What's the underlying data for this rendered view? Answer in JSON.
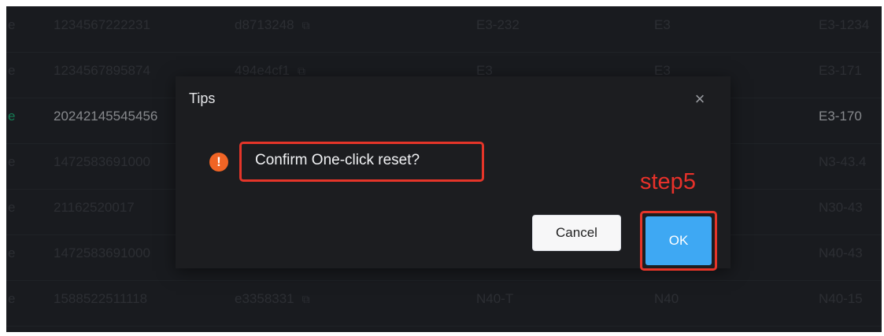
{
  "table": {
    "rows": [
      {
        "status": "e",
        "id": "1234567222231",
        "code": "d8713248",
        "loc": "E3-232",
        "zone": "E3",
        "ref": "E3-1234"
      },
      {
        "status": "e",
        "id": "1234567895874",
        "code": "494e4cf1",
        "loc": "E3",
        "zone": "E3",
        "ref": "E3-171"
      },
      {
        "status": "e",
        "id": "20242145545456",
        "code": "",
        "loc": "",
        "zone": "",
        "ref": "E3-170"
      },
      {
        "status": "e",
        "id": "1472583691000",
        "code": "",
        "loc": "",
        "zone": "",
        "ref": "N3-43.4"
      },
      {
        "status": "e",
        "id": "21162520017",
        "code": "",
        "loc": "",
        "zone": "",
        "ref": "N30-43"
      },
      {
        "status": "e",
        "id": "1472583691000",
        "code": "",
        "loc": "",
        "zone": "",
        "ref": "N40-43"
      },
      {
        "status": "e",
        "id": "1588522511118",
        "code": "e3358331",
        "loc": "N40-T",
        "zone": "N40",
        "ref": "N40-15"
      }
    ],
    "copy_glyph": "⧉"
  },
  "dialog": {
    "title": "Tips",
    "close_glyph": "×",
    "warning_glyph": "!",
    "message": "Confirm One-click reset?",
    "cancel_label": "Cancel",
    "ok_label": "OK"
  },
  "annotation": {
    "step_label": "step5"
  },
  "colors": {
    "background": "#222428",
    "accent": "#3ea8f3",
    "warning": "#f06425",
    "annotation": "#e53529",
    "status_active": "#1db87a"
  },
  "icons": {
    "close": "close-icon",
    "warning": "warning-icon",
    "copy": "copy-icon"
  }
}
